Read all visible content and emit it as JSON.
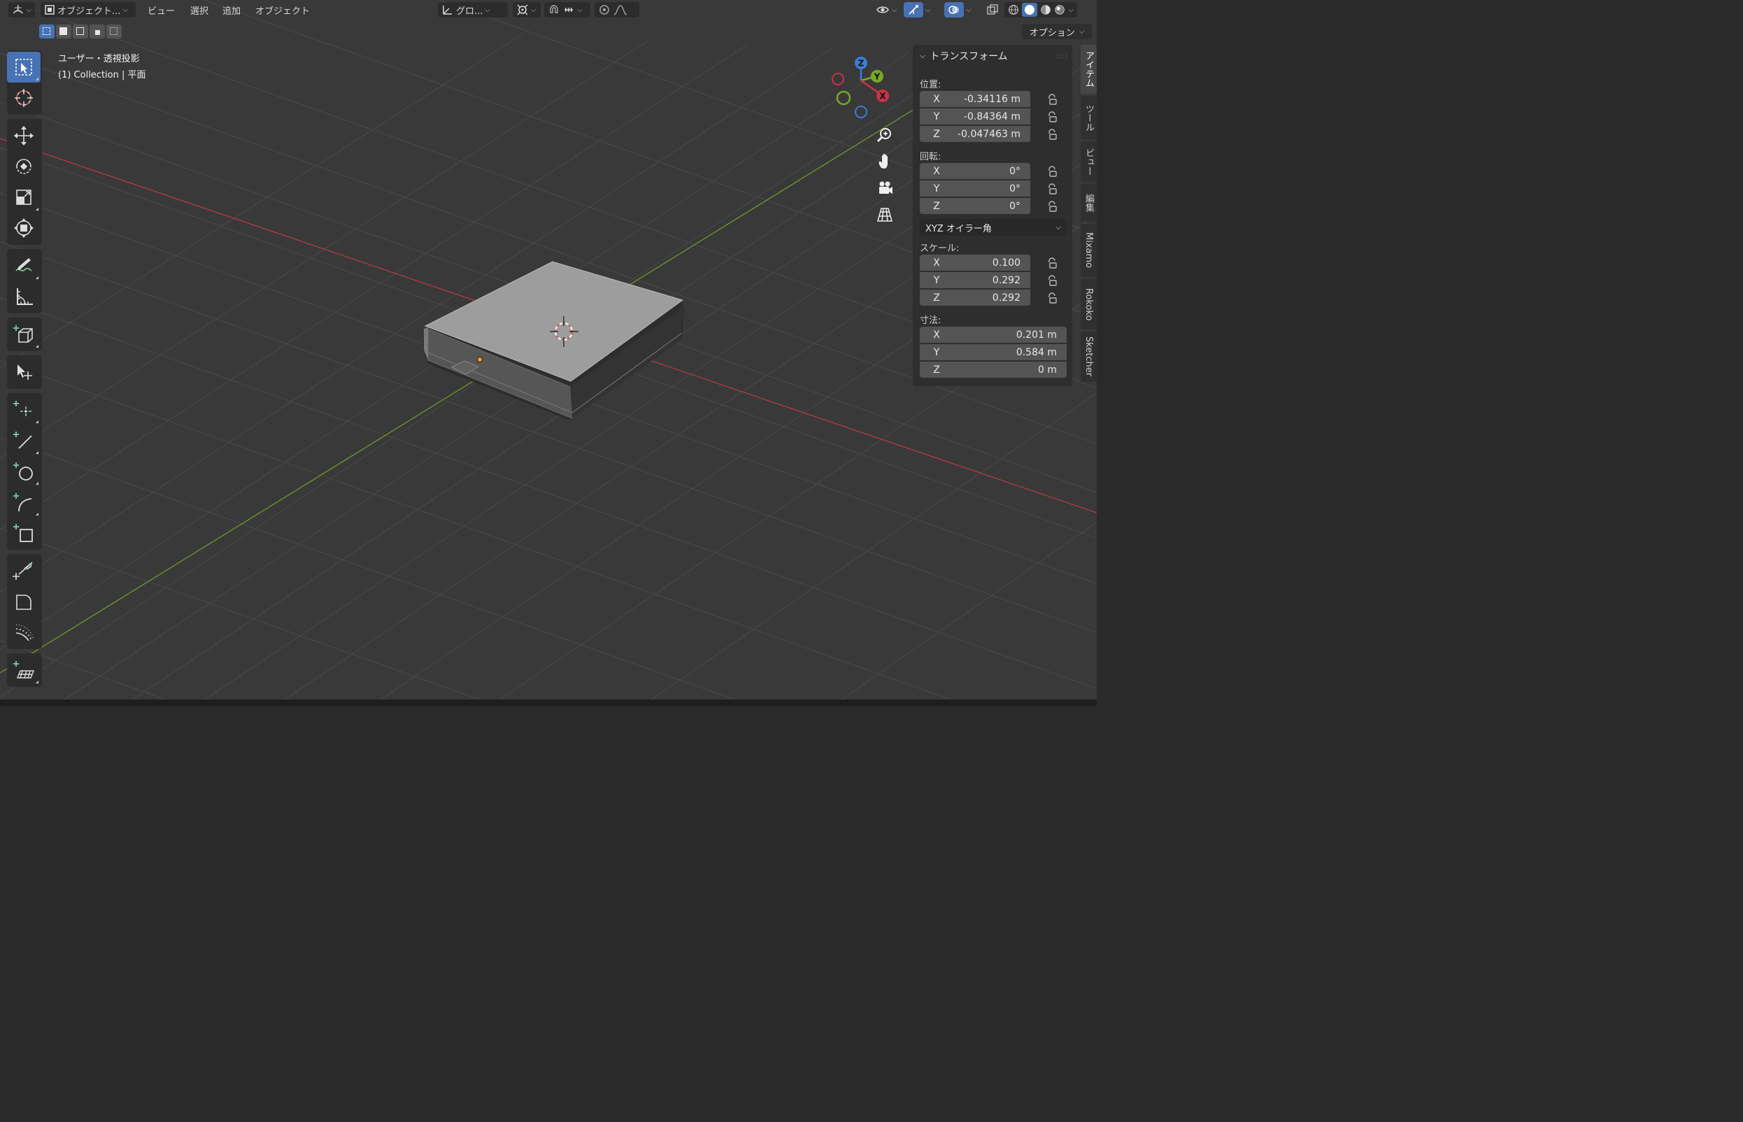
{
  "header": {
    "editor_type_icon": "grid-axis-icon",
    "mode_label": "オブジェクト...",
    "menus": [
      "ビュー",
      "選択",
      "追加",
      "オブジェクト"
    ],
    "transform_orientation": "グロ...",
    "options_label": "オプション"
  },
  "viewport": {
    "view_name": "ユーザー・透視投影",
    "collection_info": "(1) Collection | 平面"
  },
  "gizmo": {
    "x": "X",
    "y": "Y",
    "z": "Z"
  },
  "npanel": {
    "title": "トランスフォーム",
    "location": {
      "label": "位置:",
      "rows": [
        {
          "axis": "X",
          "value": "-0.34116 m"
        },
        {
          "axis": "Y",
          "value": "-0.84364 m"
        },
        {
          "axis": "Z",
          "value": "-0.047463 m"
        }
      ]
    },
    "rotation": {
      "label": "回転:",
      "rows": [
        {
          "axis": "X",
          "value": "0°"
        },
        {
          "axis": "Y",
          "value": "0°"
        },
        {
          "axis": "Z",
          "value": "0°"
        }
      ],
      "mode": "XYZ オイラー角"
    },
    "scale": {
      "label": "スケール:",
      "rows": [
        {
          "axis": "X",
          "value": "0.100"
        },
        {
          "axis": "Y",
          "value": "0.292"
        },
        {
          "axis": "Z",
          "value": "0.292"
        }
      ]
    },
    "dimensions": {
      "label": "寸法:",
      "rows": [
        {
          "axis": "X",
          "value": "0.201 m"
        },
        {
          "axis": "Y",
          "value": "0.584 m"
        },
        {
          "axis": "Z",
          "value": "0 m"
        }
      ]
    }
  },
  "sidetabs": [
    "アイテム",
    "ツール",
    "ビュー",
    "編集",
    "Mixamo",
    "Rokoko",
    "Sketcher"
  ],
  "colors": {
    "accent": "#4772b3",
    "axis_x": "#c8334a",
    "axis_y": "#7aa828",
    "axis_z": "#3a7ed6",
    "viewport_bg": "#393939"
  }
}
